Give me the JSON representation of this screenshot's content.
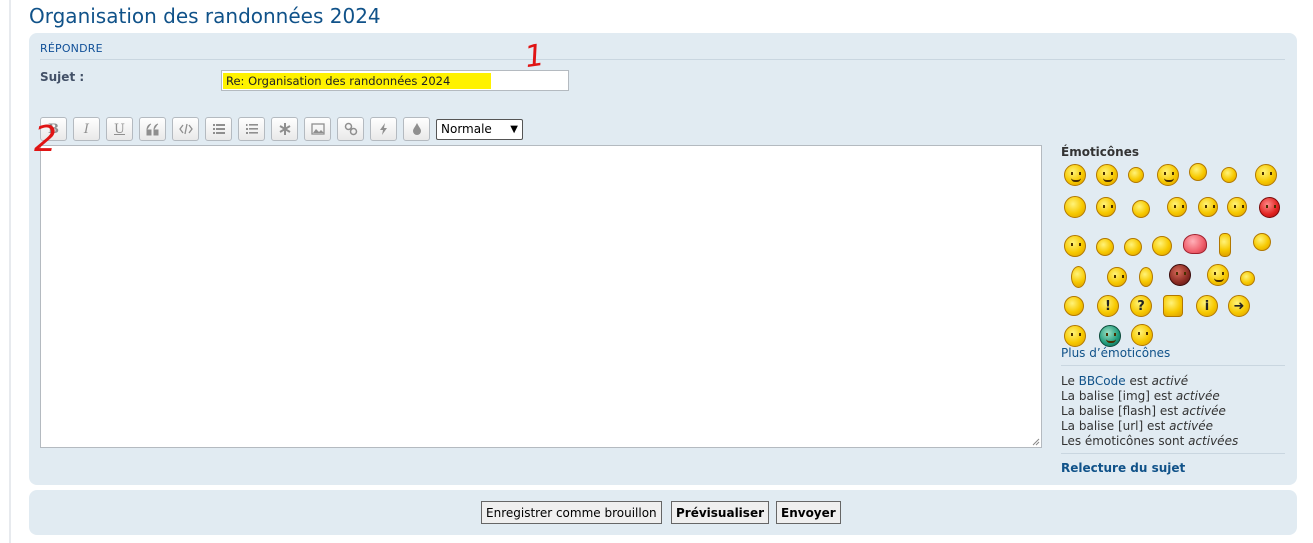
{
  "page": {
    "title": "Organisation des randonnées 2024"
  },
  "reply": {
    "heading": "RÉPONDRE",
    "subject_label": "Sujet :",
    "subject_value": "Re: Organisation des randonnées 2024"
  },
  "annotations": {
    "one": "1",
    "two": "2"
  },
  "toolbar": {
    "bold": "B",
    "italic": "I",
    "underline": "U",
    "font_size_selected": "Normale"
  },
  "smilies": {
    "title": "Émoticônes",
    "more": "Plus d’émoticônes"
  },
  "status": {
    "bbcode_prefix": "Le ",
    "bbcode_link": "BBCode",
    "bbcode_mid": " est ",
    "bbcode_state": "activé",
    "img_prefix": "La balise [img] est ",
    "img_state": "activée",
    "flash_prefix": "La balise [flash] est ",
    "flash_state": "activée",
    "url_prefix": "La balise [url] est ",
    "url_state": "activée",
    "smilies_prefix": "Les émoticônes sont ",
    "smilies_state": "activées"
  },
  "review": {
    "label": "Relecture du sujet"
  },
  "buttons": {
    "draft": "Enregistrer comme brouillon",
    "preview": "Prévisualiser",
    "submit": "Envoyer"
  },
  "colors": {
    "link": "#105289",
    "panel": "#e1ebf2",
    "highlight": "#fff200",
    "annotation": "#e01414"
  }
}
